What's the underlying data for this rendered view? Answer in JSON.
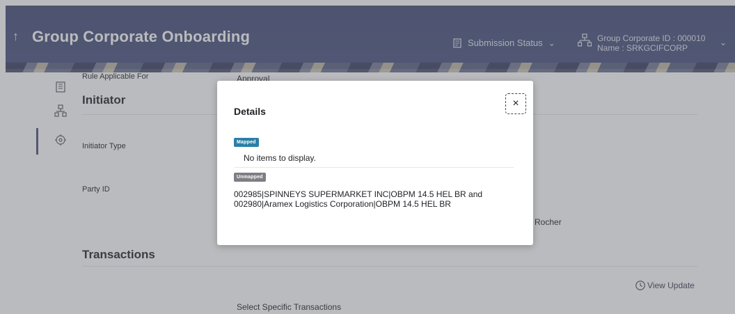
{
  "header": {
    "back_icon": "↑",
    "title": "Group Corporate Onboarding",
    "submission_status_label": "Submission Status",
    "group_corporate_id": "Group Corporate ID : 000010",
    "group_corporate_name": "Name : SRKGCIFCORP"
  },
  "page": {
    "rule_applicable_for_label": "Rule Applicable For",
    "rule_applicable_for_value": "Approval",
    "initiator_section": "Initiator",
    "initiator_type_label": "Initiator Type",
    "party_id_label": "Party ID",
    "partial_value": "ro Rocher",
    "view_update_label": "View Update",
    "transactions_section": "Transactions",
    "select_specific_transactions": "Select Specific Transactions"
  },
  "modal": {
    "title": "Details",
    "close_icon": "×",
    "mapped_badge": "Mapped",
    "mapped_empty": "No items to display.",
    "unmapped_badge": "Unmapped",
    "unmapped_line1": "002985|SPINNEYS SUPERMARKET INC|OBPM 14.5 HEL BR and",
    "unmapped_line2": "002980|Aramex Logistics Corporation|OBPM 14.5 HEL BR"
  },
  "colors": {
    "header_bg": "#4a5380",
    "mapped_badge": "#2a7fa6",
    "unmapped_badge": "#7e7e84"
  }
}
